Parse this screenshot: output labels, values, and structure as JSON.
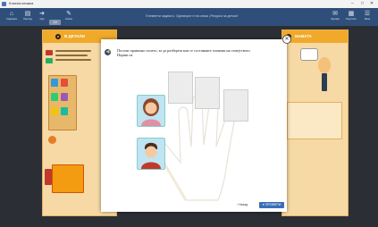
{
  "window": {
    "title": "Класна книжка",
    "controls": [
      "–",
      "□",
      "✕"
    ]
  },
  "toolbar": {
    "title": "Елементи задачи к. Одговорот е на слика „Ресурси за детски“",
    "page_number": "14",
    "buttons": [
      {
        "label": "Содржина",
        "icon": "home-icon"
      },
      {
        "label": "Преглед",
        "icon": "book-icon"
      },
      {
        "label": "Оди",
        "icon": "arrow-icon"
      },
      {
        "label": "Алатки",
        "icon": "pencil-icon"
      },
      {
        "label": "Одговор",
        "icon": "comment-icon"
      },
      {
        "label": "Резултати",
        "icon": "chart-icon"
      },
      {
        "label": "Мени",
        "icon": "menu-icon"
      }
    ]
  },
  "pages": {
    "left_header": "В ДЕТАЛИ",
    "right_header": "МАВАТА"
  },
  "dialog": {
    "instruction": "Посочи правилно полето, за да разбереш кои се составните членови на семејството. Најави ги.",
    "back_label": "‹ Назад",
    "check_label": "● ПРОВЕРИ",
    "close_glyph": "✕"
  },
  "colors": {
    "accent": "#f0a92a",
    "toolbar": "#2f4f7a",
    "primary_button": "#3b6fb6"
  }
}
